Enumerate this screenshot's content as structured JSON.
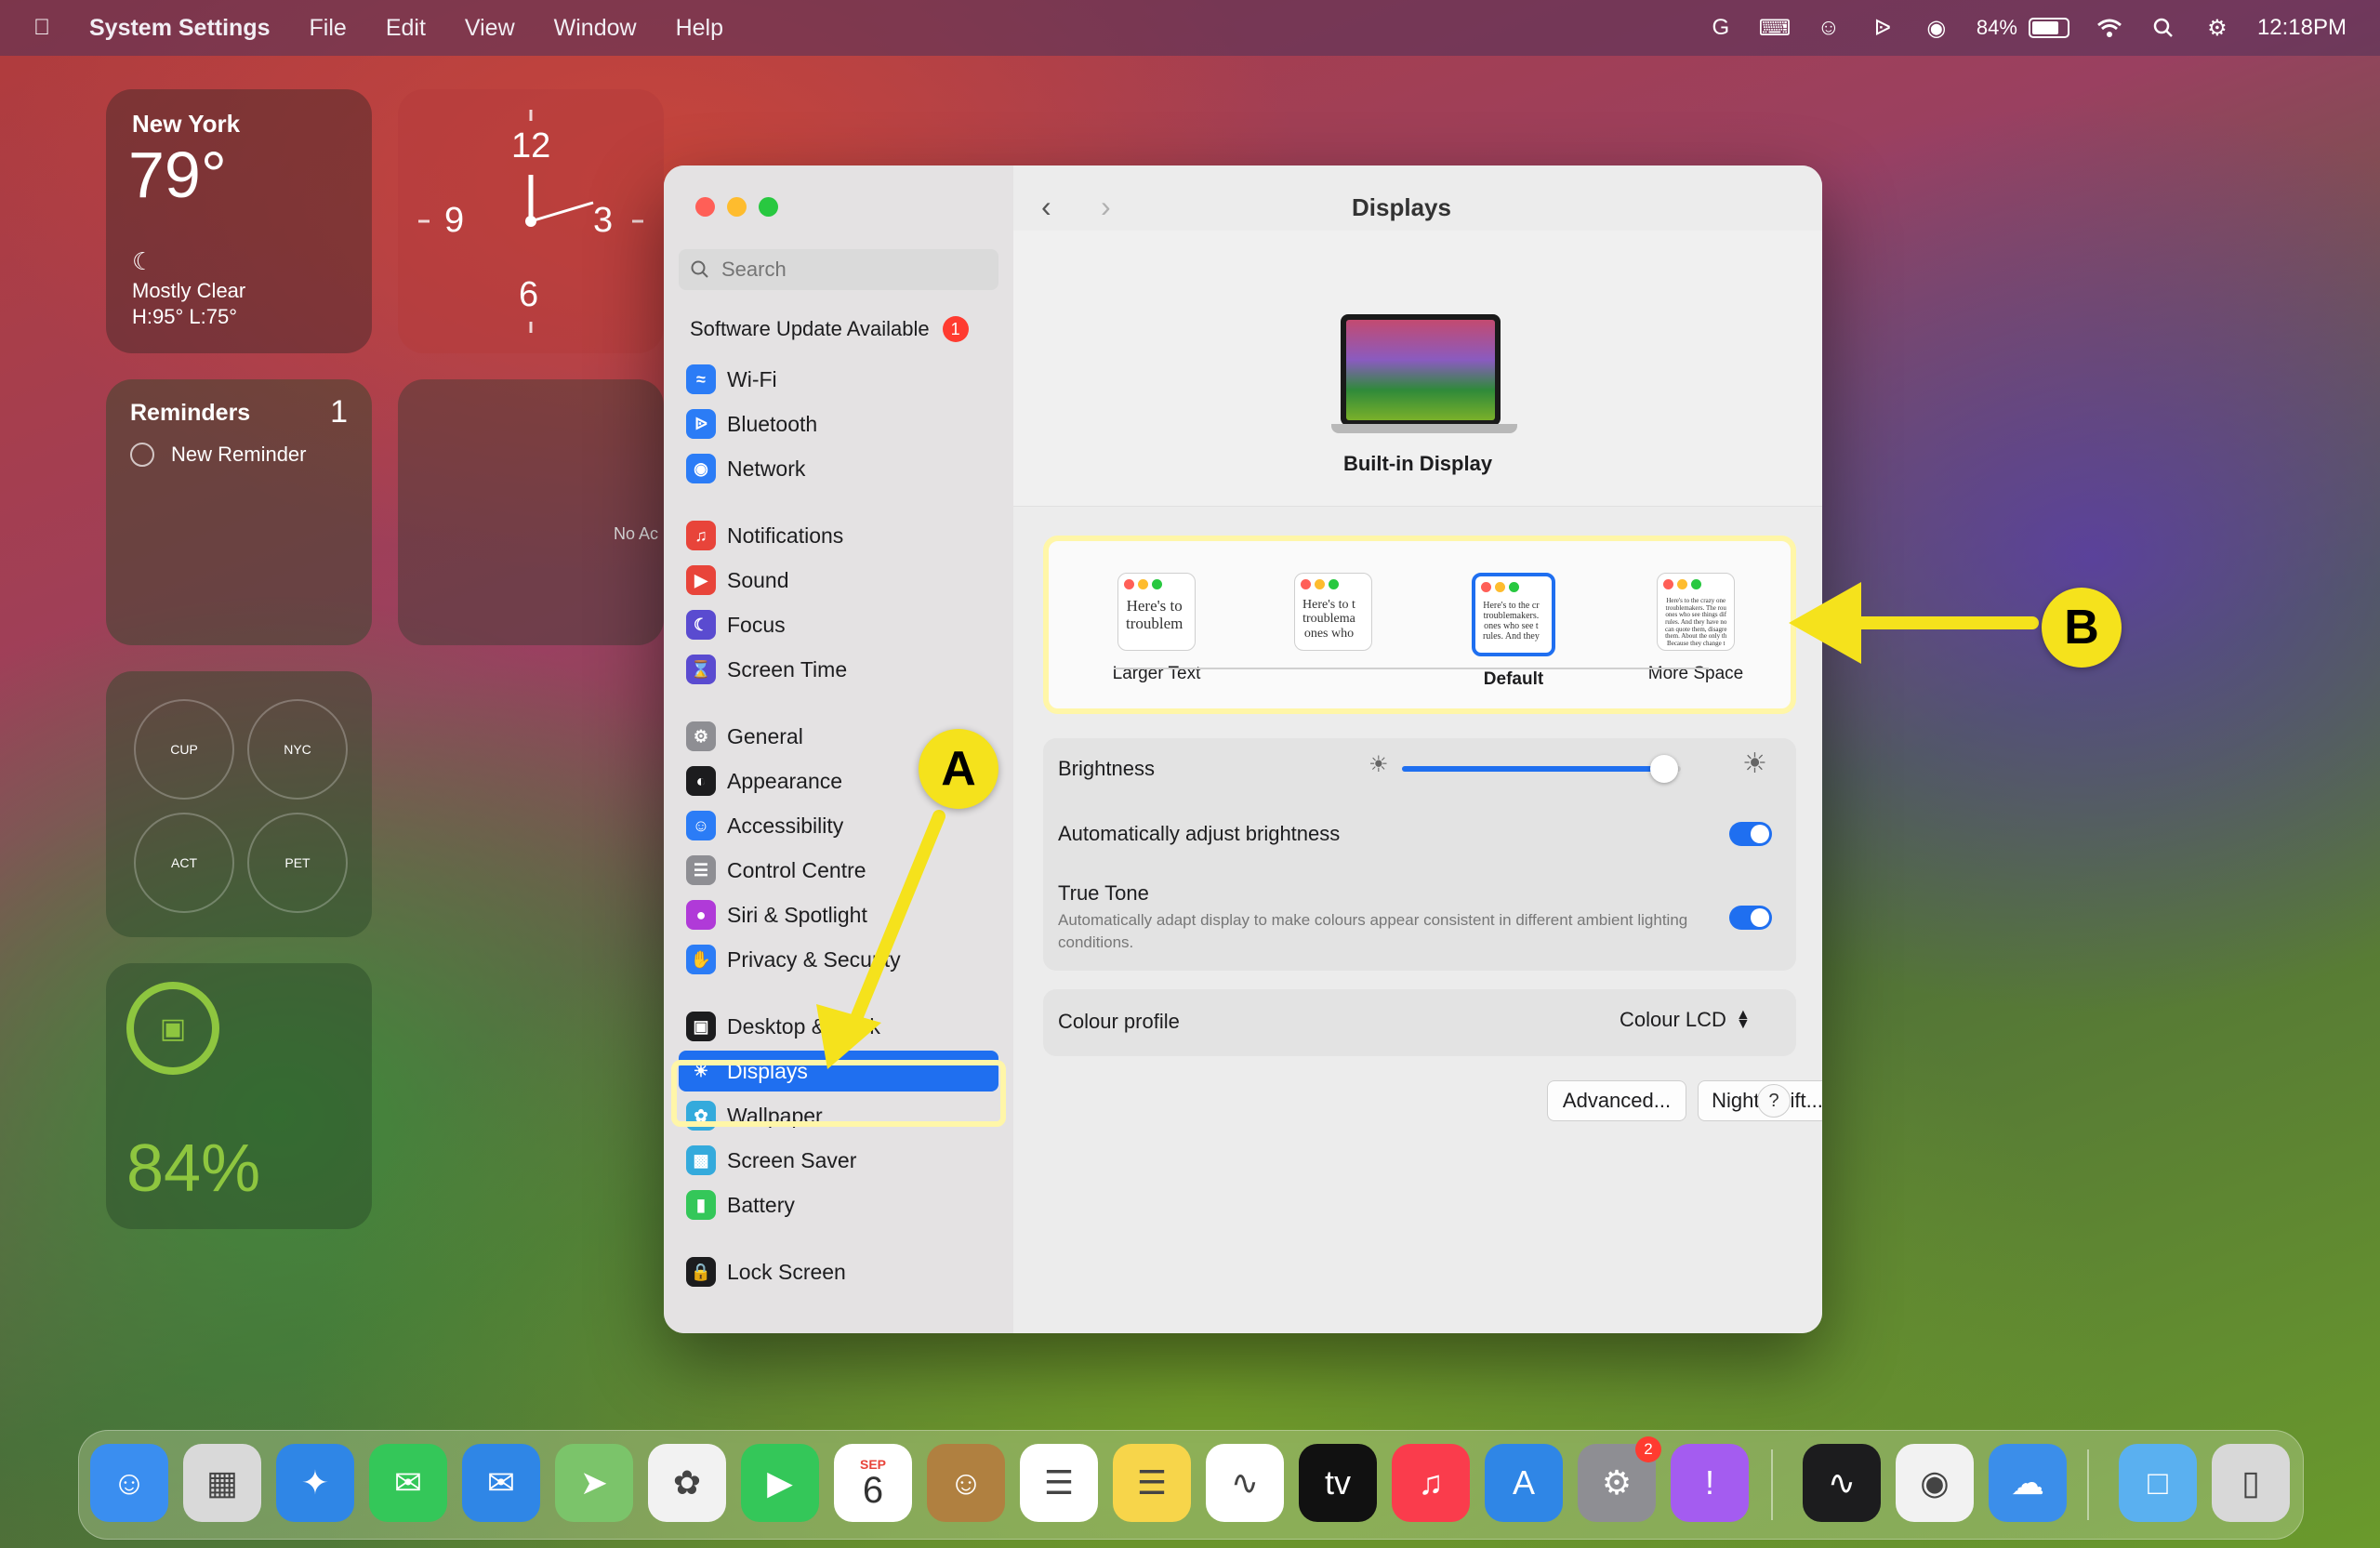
{
  "menubar": {
    "app_name": "System Settings",
    "menus": [
      "File",
      "Edit",
      "View",
      "Window",
      "Help"
    ],
    "battery_percent": "84%",
    "time": "12:18PM"
  },
  "widgets": {
    "weather": {
      "city": "New York",
      "temp": "79°",
      "condition": "Mostly Clear",
      "range": "H:95° L:75°"
    },
    "clock": {
      "numbers": [
        "12",
        "3",
        "6",
        "9"
      ]
    },
    "reminders": {
      "title": "Reminders",
      "count": "1",
      "item": "New Reminder"
    },
    "no_access_text": "No Ac",
    "world_clocks": [
      "CUP",
      "NYC",
      "ACT",
      "PET"
    ],
    "battery": {
      "percent": "84%"
    }
  },
  "window": {
    "search_placeholder": "Search",
    "software_update": {
      "label": "Software Update Available",
      "badge": "1"
    },
    "sidebar_items": [
      {
        "label": "Wi-Fi",
        "color": "#2b7cf6",
        "icon": "wifi-icon"
      },
      {
        "label": "Bluetooth",
        "color": "#2b7cf6",
        "icon": "bluetooth-icon"
      },
      {
        "label": "Network",
        "color": "#2b7cf6",
        "icon": "globe-icon"
      },
      {
        "label": "Notifications",
        "color": "#e8443a",
        "icon": "bell-icon"
      },
      {
        "label": "Sound",
        "color": "#e8443a",
        "icon": "speaker-icon"
      },
      {
        "label": "Focus",
        "color": "#5a4bd0",
        "icon": "moon-icon"
      },
      {
        "label": "Screen Time",
        "color": "#5a4bd0",
        "icon": "hourglass-icon"
      },
      {
        "label": "General",
        "color": "#8e8e93",
        "icon": "gear-icon"
      },
      {
        "label": "Appearance",
        "color": "#1c1c1e",
        "icon": "appearance-icon"
      },
      {
        "label": "Accessibility",
        "color": "#2b7cf6",
        "icon": "accessibility-icon"
      },
      {
        "label": "Control Centre",
        "color": "#8e8e93",
        "icon": "control-centre-icon"
      },
      {
        "label": "Siri & Spotlight",
        "color": "#b03ad8",
        "icon": "siri-icon"
      },
      {
        "label": "Privacy & Security",
        "color": "#2b7cf6",
        "icon": "hand-icon"
      },
      {
        "label": "Desktop & Dock",
        "color": "#1c1c1e",
        "icon": "dock-icon"
      },
      {
        "label": "Displays",
        "color": "#2b7cf6",
        "icon": "sun-icon"
      },
      {
        "label": "Wallpaper",
        "color": "#34aadc",
        "icon": "wallpaper-icon"
      },
      {
        "label": "Screen Saver",
        "color": "#34aadc",
        "icon": "screen-saver-icon"
      },
      {
        "label": "Battery",
        "color": "#34c759",
        "icon": "battery-icon"
      },
      {
        "label": "Lock Screen",
        "color": "#1c1c1e",
        "icon": "lock-icon"
      }
    ],
    "title": "Displays",
    "display_name": "Built-in Display",
    "resolutions": [
      {
        "label": "Larger Text",
        "sample": "Here's to\ntroublem"
      },
      {
        "label": "",
        "sample": "Here's to t\ntroublema\nones who"
      },
      {
        "label": "Default",
        "sample": "Here's to the cr\ntroublemakers.\nones who see t\nrules. And they"
      },
      {
        "label": "More Space",
        "sample": "Here's to the crazy one\ntroublemakers. The rou\nones who see things dif\nrules. And they have no\ncan quote them, disagre\nthem. About the only th\nBecause they change t"
      }
    ],
    "brightness": {
      "label": "Brightness",
      "value": 0.94
    },
    "auto_brightness": {
      "label": "Automatically adjust brightness",
      "on": true
    },
    "true_tone": {
      "label": "True Tone",
      "description": "Automatically adapt display to make colours appear consistent in different ambient lighting conditions.",
      "on": true
    },
    "colour_profile": {
      "label": "Colour profile",
      "value": "Colour LCD"
    },
    "buttons": {
      "advanced": "Advanced...",
      "night_shift": "Night Shift...",
      "help": "?"
    }
  },
  "annotations": {
    "a": "A",
    "b": "B"
  },
  "dock": {
    "calendar_month": "SEP",
    "calendar_day": "6",
    "settings_badge": "2",
    "apps": [
      {
        "name": "finder-icon",
        "color": "#3a8ef0"
      },
      {
        "name": "launchpad-icon",
        "color": "#d9d9d9"
      },
      {
        "name": "safari-icon",
        "color": "#2f86e6"
      },
      {
        "name": "messages-icon",
        "color": "#34c759"
      },
      {
        "name": "mail-icon",
        "color": "#2f86e6"
      },
      {
        "name": "maps-icon",
        "color": "#7bc46a"
      },
      {
        "name": "photos-icon",
        "color": "#f2f2f2"
      },
      {
        "name": "facetime-icon",
        "color": "#34c759"
      },
      {
        "name": "calendar-icon",
        "color": "#ffffff"
      },
      {
        "name": "contacts-icon",
        "color": "#b08040"
      },
      {
        "name": "reminders-icon",
        "color": "#ffffff"
      },
      {
        "name": "notes-icon",
        "color": "#f7d54a"
      },
      {
        "name": "freeform-icon",
        "color": "#ffffff"
      },
      {
        "name": "tv-icon",
        "color": "#111111"
      },
      {
        "name": "music-icon",
        "color": "#fa3c4c"
      },
      {
        "name": "app-store-icon",
        "color": "#2f86e6"
      },
      {
        "name": "system-settings-icon",
        "color": "#8e8e93"
      },
      {
        "name": "feedback-icon",
        "color": "#a45cf0"
      },
      {
        "name": "voice-memos-icon",
        "color": "#1c1c1e"
      },
      {
        "name": "chrome-icon",
        "color": "#f2f2f2"
      },
      {
        "name": "icloud-icon",
        "color": "#3b8eea"
      },
      {
        "name": "folder-icon",
        "color": "#5ab0f0"
      },
      {
        "name": "trash-icon",
        "color": "#d8d8d8"
      }
    ]
  }
}
